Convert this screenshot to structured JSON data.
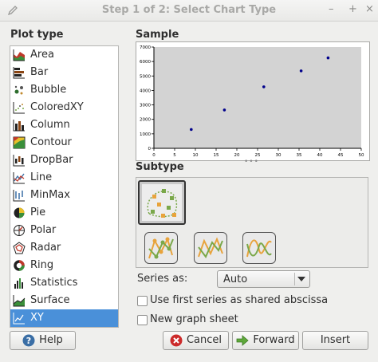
{
  "window": {
    "title": "Step 1 of 2: Select Chart Type"
  },
  "titlebar_buttons": {
    "minimize": "–",
    "maximize": "+",
    "close": "×"
  },
  "plot_type": {
    "label": "Plot type",
    "items": [
      {
        "label": "Area",
        "icon": "area-chart-icon"
      },
      {
        "label": "Bar",
        "icon": "bar-chart-icon"
      },
      {
        "label": "Bubble",
        "icon": "bubble-chart-icon"
      },
      {
        "label": "ColoredXY",
        "icon": "colored-xy-icon"
      },
      {
        "label": "Column",
        "icon": "column-chart-icon"
      },
      {
        "label": "Contour",
        "icon": "contour-chart-icon"
      },
      {
        "label": "DropBar",
        "icon": "dropbar-chart-icon"
      },
      {
        "label": "Line",
        "icon": "line-chart-icon"
      },
      {
        "label": "MinMax",
        "icon": "minmax-chart-icon"
      },
      {
        "label": "Pie",
        "icon": "pie-chart-icon"
      },
      {
        "label": "Polar",
        "icon": "polar-chart-icon"
      },
      {
        "label": "Radar",
        "icon": "radar-chart-icon"
      },
      {
        "label": "Ring",
        "icon": "ring-chart-icon"
      },
      {
        "label": "Statistics",
        "icon": "statistics-chart-icon"
      },
      {
        "label": "Surface",
        "icon": "surface-chart-icon"
      },
      {
        "label": "XY",
        "icon": "xy-chart-icon"
      }
    ],
    "selected": "XY"
  },
  "sample": {
    "label": "Sample"
  },
  "chart_data": {
    "type": "scatter",
    "title": "",
    "xlabel": "",
    "ylabel": "",
    "xlim": [
      0,
      50
    ],
    "ylim": [
      0,
      7000
    ],
    "x_ticks": [
      "0",
      "5",
      "10",
      "15",
      "20",
      "25",
      "30",
      "35",
      "40",
      "45",
      "50"
    ],
    "y_ticks": [
      "0",
      "1000",
      "2000",
      "3000",
      "4000",
      "5000",
      "6000",
      "7000"
    ],
    "series": [
      {
        "x": [
          9,
          17,
          26.5,
          35.5,
          42
        ],
        "y": [
          1300,
          2650,
          4250,
          5350,
          6250
        ]
      }
    ],
    "colors": {
      "point": "#00008b",
      "plot_bg": "#d3d3d3"
    },
    "grid": false,
    "legend": "none"
  },
  "subtype": {
    "label": "Subtype",
    "items": [
      {
        "name": "markers-only",
        "icon": "scatter-markers-icon",
        "selected": true
      },
      {
        "name": "lines-and-markers",
        "icon": "lines-markers-icon",
        "selected": false
      },
      {
        "name": "lines-only",
        "icon": "lines-only-icon",
        "selected": false
      },
      {
        "name": "smooth-lines",
        "icon": "smooth-lines-icon",
        "selected": false
      }
    ]
  },
  "series_as": {
    "label": "Series as:",
    "value": "Auto"
  },
  "options": {
    "shared_abscissa": {
      "label": "Use first series as shared abscissa",
      "checked": false
    },
    "new_sheet": {
      "label": "New graph sheet",
      "checked": false
    }
  },
  "buttons": {
    "help": "Help",
    "cancel": "Cancel",
    "forward": "Forward",
    "insert": "Insert"
  },
  "colors": {
    "selection": "#4a90d9",
    "accent_orange": "#e8a33c",
    "accent_green": "#7aa84a"
  }
}
